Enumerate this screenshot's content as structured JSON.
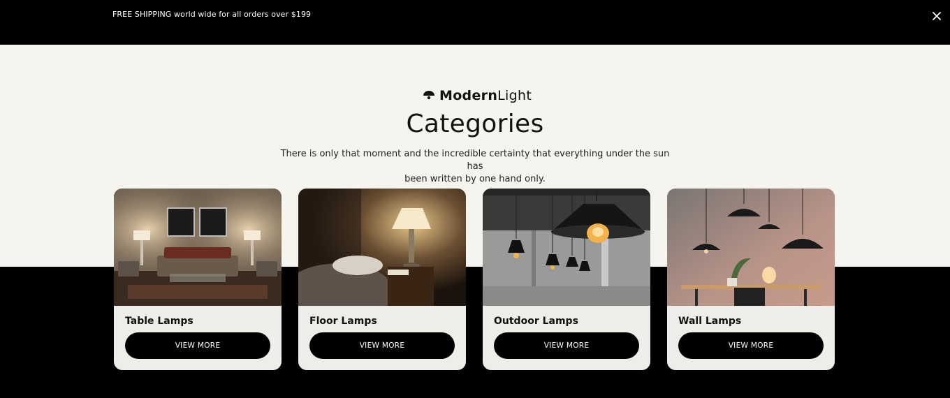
{
  "announcement": {
    "text": "FREE SHIPPING world wide for all orders over $199",
    "close_icon": "close-icon"
  },
  "brand": {
    "name_bold": "Modern",
    "name_light": "Light",
    "logo_icon": "lamp-icon"
  },
  "section": {
    "title": "Categories",
    "subtitle_line1": "There is only that moment and the incredible certainty that everything under the sun has",
    "subtitle_line2": "been written by one hand only."
  },
  "categories": [
    {
      "title": "Table Lamps",
      "button": "VIEW MORE"
    },
    {
      "title": "Floor Lamps",
      "button": "VIEW MORE"
    },
    {
      "title": "Outdoor Lamps",
      "button": "VIEW MORE"
    },
    {
      "title": "Wall Lamps",
      "button": "VIEW MORE"
    }
  ],
  "colors": {
    "background_light": "#f5f4ef",
    "background_dark": "#000000",
    "card": "#eeede7",
    "button": "#000000"
  }
}
